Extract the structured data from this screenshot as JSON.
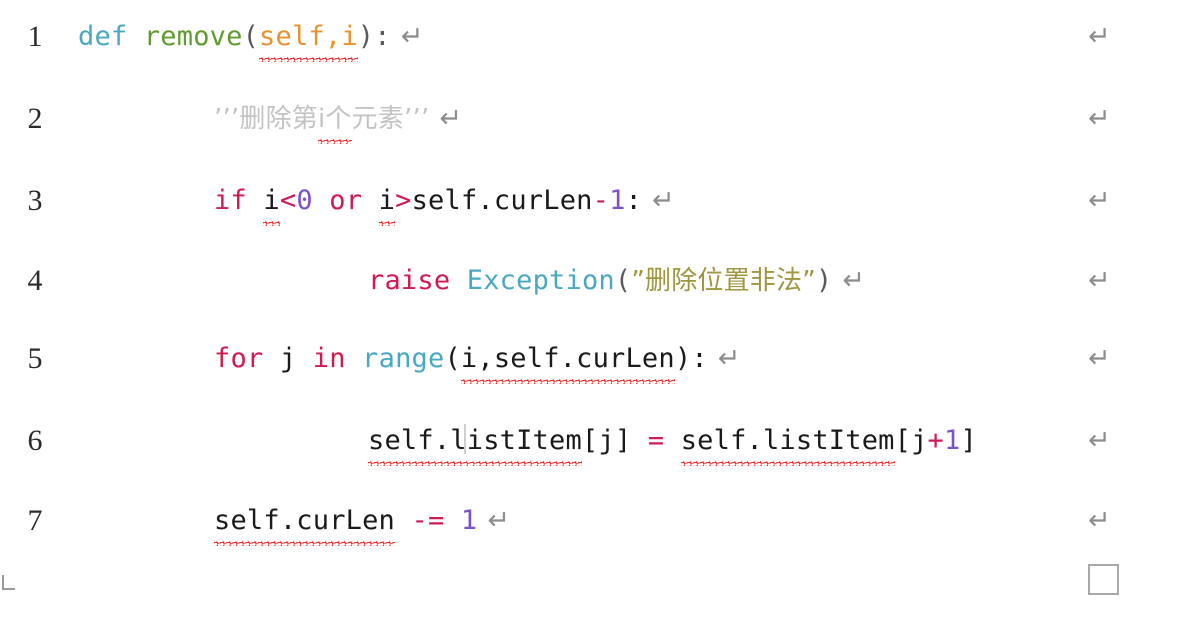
{
  "document": {
    "kind": "word-processor-code-snippet",
    "language": "Python",
    "background_color": "#ffffff",
    "end_of_document_marker": "□",
    "margin_corner_marker": "└",
    "return_mark_glyph": "↵"
  },
  "palette": {
    "keyword": "#D01A52",
    "builtin_teal": "#4AA8C0",
    "function_name": "#5F9B2D",
    "parameter_orange": "#E8932F",
    "number_purple": "#7B52C8",
    "string_khaki": "#A0963F",
    "comment_gray": "#c3c3c3",
    "plain_text": "#1a1a1a",
    "punctuation_gray": "#5a5a5a",
    "spellcheck_red": "#f01a1a",
    "line_number": "#2b2b2b",
    "return_mark_gray": "#8d8d8d"
  },
  "code": {
    "line_numbers": [
      "1",
      "2",
      "3",
      "4",
      "5",
      "6",
      "7"
    ],
    "lines": [
      {
        "number": "1",
        "indent": 0,
        "plain_text": "def remove(self,i):",
        "tokens": [
          {
            "t": "def",
            "c": "kw-def"
          },
          {
            "t": " ",
            "c": "plain"
          },
          {
            "t": "remove",
            "c": "fn-name"
          },
          {
            "t": "(",
            "c": "punct"
          },
          {
            "t": "self,i",
            "c": "param",
            "squiggle": true
          },
          {
            "t": ")",
            "c": "punct"
          },
          {
            "t": ":",
            "c": "punct"
          }
        ],
        "trailing_return": true,
        "margin_return": true
      },
      {
        "number": "2",
        "indent": 1,
        "plain_text": "'''删除第i个元素'''",
        "tokens": [
          {
            "t": "’’’删除第",
            "c": "comment",
            "cjk": true
          },
          {
            "t": "i个",
            "c": "comment",
            "cjk": true,
            "squiggle": true
          },
          {
            "t": "元素’’’",
            "c": "comment",
            "cjk": true
          }
        ],
        "trailing_return": true,
        "margin_return": true
      },
      {
        "number": "3",
        "indent": 1,
        "plain_text": "if i<0 or i>self.curLen-1:",
        "tokens": [
          {
            "t": "if",
            "c": "kw"
          },
          {
            "t": " ",
            "c": "plain"
          },
          {
            "t": "i",
            "c": "plain",
            "squiggle": true
          },
          {
            "t": "<",
            "c": "kw"
          },
          {
            "t": "0",
            "c": "num"
          },
          {
            "t": " ",
            "c": "plain"
          },
          {
            "t": "or",
            "c": "kw"
          },
          {
            "t": " ",
            "c": "plain"
          },
          {
            "t": "i",
            "c": "plain",
            "squiggle": true
          },
          {
            "t": ">",
            "c": "kw"
          },
          {
            "t": "self.curLen",
            "c": "plain"
          },
          {
            "t": "-",
            "c": "kw"
          },
          {
            "t": "1",
            "c": "num"
          },
          {
            "t": ":",
            "c": "plain"
          }
        ],
        "trailing_return": true,
        "margin_return": true
      },
      {
        "number": "4",
        "indent": 2,
        "plain_text": "raise Exception(”删除位置非法”)",
        "tokens": [
          {
            "t": "raise",
            "c": "kw"
          },
          {
            "t": " ",
            "c": "plain"
          },
          {
            "t": "Exception",
            "c": "kw-def"
          },
          {
            "t": "(",
            "c": "punct"
          },
          {
            "t": "”删除位置非法”",
            "c": "str",
            "cjk": true
          },
          {
            "t": ")",
            "c": "punct"
          }
        ],
        "trailing_return": true,
        "margin_return": true
      },
      {
        "number": "5",
        "indent": 1,
        "plain_text": "for j in range(i,self.curLen):",
        "tokens": [
          {
            "t": "for",
            "c": "kw"
          },
          {
            "t": " ",
            "c": "plain"
          },
          {
            "t": "j",
            "c": "plain"
          },
          {
            "t": " ",
            "c": "plain"
          },
          {
            "t": "in",
            "c": "kw"
          },
          {
            "t": " ",
            "c": "plain"
          },
          {
            "t": "range",
            "c": "kw-def"
          },
          {
            "t": "(",
            "c": "plain"
          },
          {
            "t": "i,self.curLen",
            "c": "plain",
            "squiggle": true
          },
          {
            "t": ")",
            "c": "plain"
          },
          {
            "t": ":",
            "c": "plain"
          }
        ],
        "trailing_return": true,
        "margin_return": true
      },
      {
        "number": "6",
        "indent": 2,
        "plain_text": "self.listItem[j] = self.listItem[j+1]",
        "tokens": [
          {
            "t": "self.listItem",
            "c": "plain",
            "squiggle": true
          },
          {
            "t": "[j]",
            "c": "plain"
          },
          {
            "t": " ",
            "c": "plain"
          },
          {
            "t": "=",
            "c": "kw"
          },
          {
            "t": " ",
            "c": "plain"
          },
          {
            "t": "self.listItem",
            "c": "plain",
            "squiggle": true
          },
          {
            "t": "[j",
            "c": "plain"
          },
          {
            "t": "+",
            "c": "kw"
          },
          {
            "t": "1",
            "c": "num"
          },
          {
            "t": "]",
            "c": "plain"
          }
        ],
        "trailing_return": false,
        "margin_return": true,
        "has_caret": true
      },
      {
        "number": "7",
        "indent": 1,
        "plain_text": "self.curLen -= 1",
        "tokens": [
          {
            "t": "self.curLen",
            "c": "plain",
            "squiggle": true
          },
          {
            "t": " ",
            "c": "plain"
          },
          {
            "t": "-=",
            "c": "kw"
          },
          {
            "t": " ",
            "c": "plain"
          },
          {
            "t": "1",
            "c": "num"
          }
        ],
        "trailing_return": true,
        "margin_return": true
      }
    ]
  }
}
